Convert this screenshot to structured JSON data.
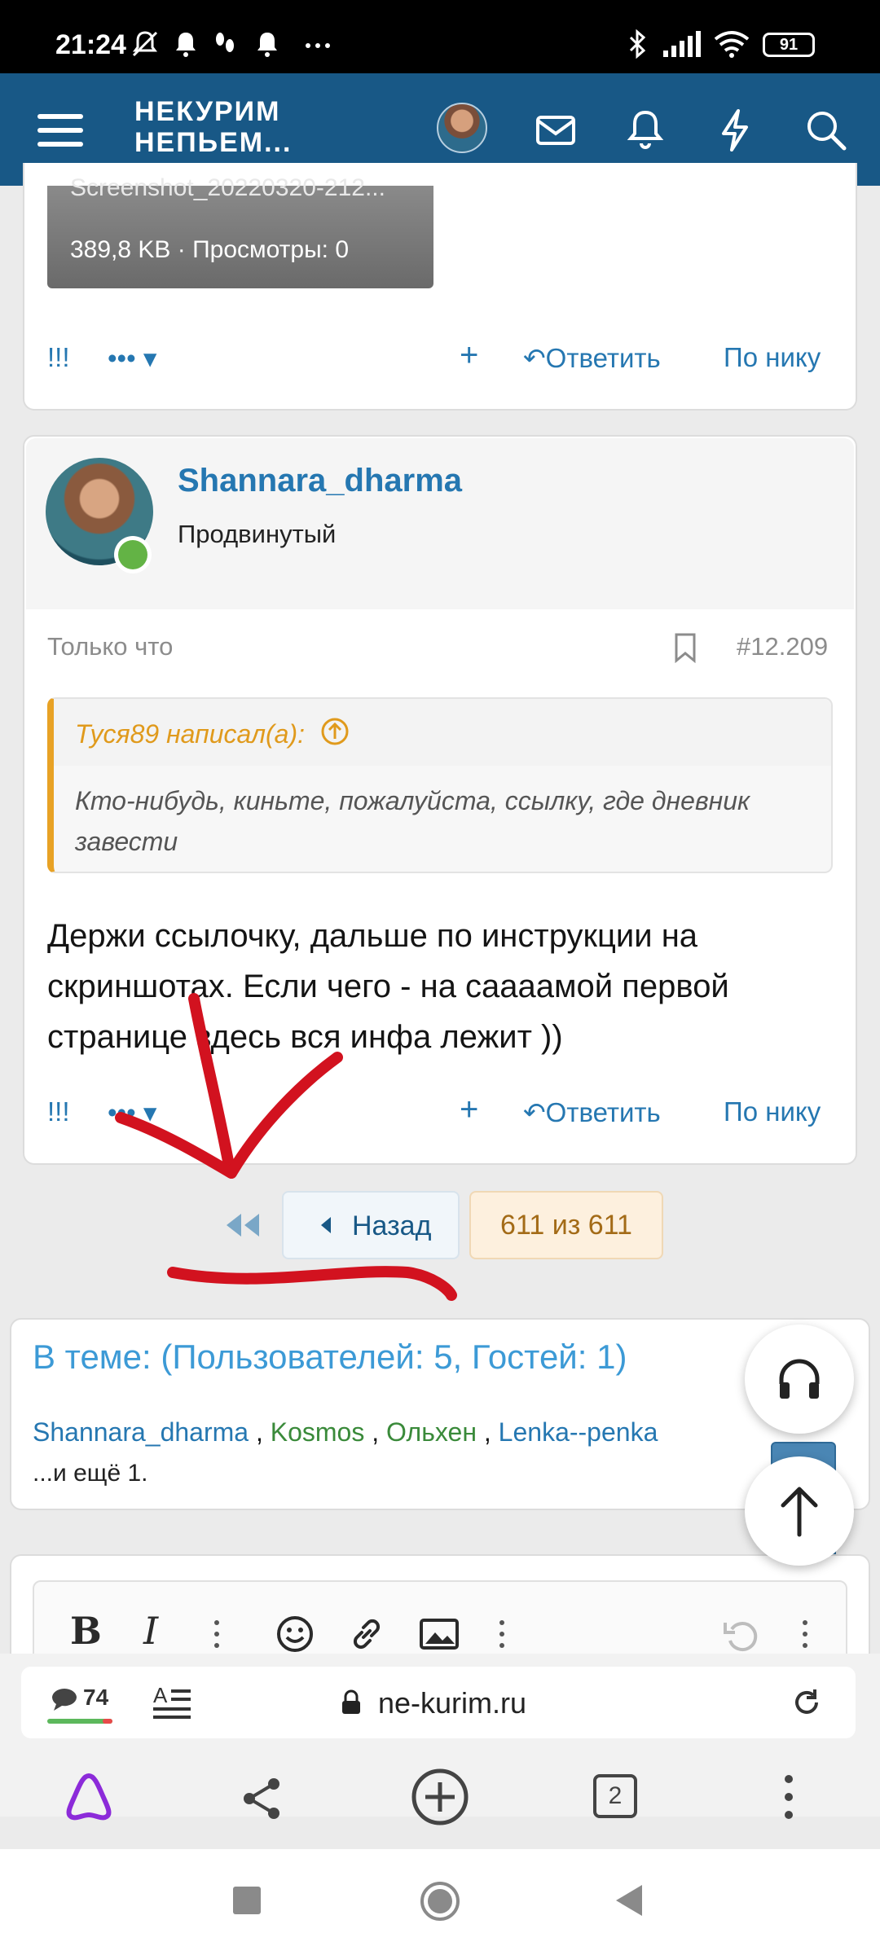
{
  "status_bar": {
    "time": "21:24",
    "battery": "91"
  },
  "header": {
    "logo_line1": "НЕКУРИМ",
    "logo_line2": "НЕПЬЕМ..."
  },
  "prev_post": {
    "attachment_filename": "Screenshot_20220320-212...",
    "attachment_meta": "389,8 KB · Просмотры: 0",
    "action_flag": "!!!",
    "action_more": "•••",
    "action_plus": "+",
    "action_reply": "Ответить",
    "action_by_nick": "По нику"
  },
  "post": {
    "username": "Shannara_dharma",
    "user_title": "Продвинутый",
    "time": "Только что",
    "number": "#12.209",
    "quote_author": "Туся89 написал(а):",
    "quote_text": "Кто-нибудь, киньте, пожалуйста, ссылку, где дневник завести",
    "body_line1": "Держи ссылочку, дальше по инструкции на",
    "body_line2": "скриншотах. Если чего - на саааамой первой",
    "body_line3": "странице здесь вся инфа лежит ))",
    "action_flag": "!!!",
    "action_more": "•••",
    "action_plus": "+",
    "action_reply": "Ответить",
    "action_by_nick": "По нику"
  },
  "pager": {
    "back_label": "Назад",
    "current": "611 из 611"
  },
  "online": {
    "title": "В теме: (Пользователей: 5, Гостей: 1)",
    "users": [
      {
        "name": "Shannara_dharma",
        "color": "#2577b1"
      },
      {
        "name": "Kosmos",
        "color": "#3a8a3a"
      },
      {
        "name": "Ольхен",
        "color": "#3a8a3a"
      },
      {
        "name": "Lenka--penka",
        "color": "#2577b1"
      }
    ],
    "separator": " , ",
    "more": "...и ещё 1."
  },
  "editor": {
    "bold": "B",
    "italic": "I"
  },
  "browser": {
    "comments_count": "74",
    "url": "ne-kurim.ru",
    "tabs_count": "2"
  },
  "colors": {
    "header_bg": "#185886",
    "link": "#2577b1",
    "quote_accent": "#e8a225",
    "annotation_red": "#d2121f"
  }
}
